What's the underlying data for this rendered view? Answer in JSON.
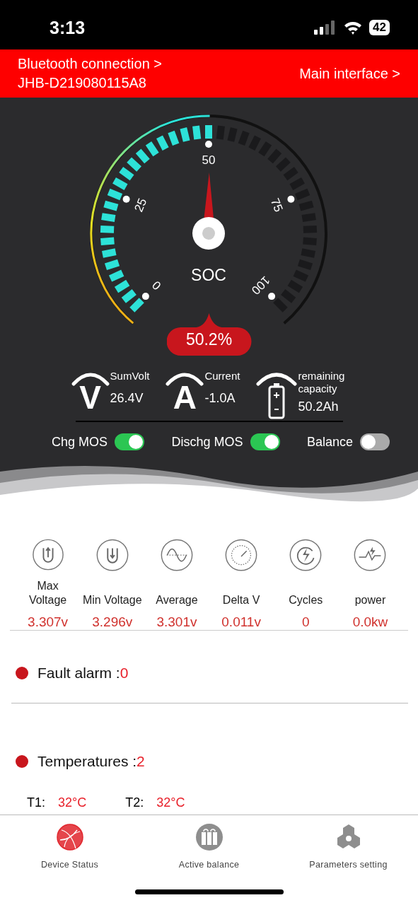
{
  "status_bar": {
    "time": "3:13",
    "battery": "42"
  },
  "header": {
    "bluetooth_label": "Bluetooth connection >",
    "device_id": "JHB-D219080115A8",
    "main_link": "Main interface >"
  },
  "gauge": {
    "label": "SOC",
    "ticks": [
      "0",
      "25",
      "50",
      "75",
      "100"
    ],
    "reading": "50.2%"
  },
  "readings": [
    {
      "kind": "letter",
      "symbol": "V",
      "label": "SumVolt",
      "value": "26.4V"
    },
    {
      "kind": "letter",
      "symbol": "A",
      "label": "Current",
      "value": "-1.0A"
    },
    {
      "kind": "battery",
      "label": "remaining capacity",
      "value": "50.2Ah"
    }
  ],
  "switches": [
    {
      "label": "Chg MOS",
      "on": true
    },
    {
      "label": "Dischg MOS",
      "on": true
    },
    {
      "label": "Balance",
      "on": false
    }
  ],
  "metrics": [
    {
      "label": "Max Voltage",
      "value": "3.307v"
    },
    {
      "label": "Min Voltage",
      "value": "3.296v"
    },
    {
      "label": "Average",
      "value": "3.301v"
    },
    {
      "label": "Delta V",
      "value": "0.011v"
    },
    {
      "label": "Cycles",
      "value": "0"
    },
    {
      "label": "power",
      "value": "0.0kw"
    }
  ],
  "fault_alarm": {
    "label": "Fault alarm :",
    "value": "0"
  },
  "temperatures": {
    "label": "Temperatures :",
    "value": "2",
    "sensors": [
      {
        "label": "T1:",
        "value": "32°C"
      },
      {
        "label": "T2:",
        "value": "32°C"
      }
    ]
  },
  "nav": [
    {
      "label": "Device Status",
      "selected": true
    },
    {
      "label": "Active balance",
      "selected": false
    },
    {
      "label": "Parameters setting",
      "selected": false
    }
  ]
}
